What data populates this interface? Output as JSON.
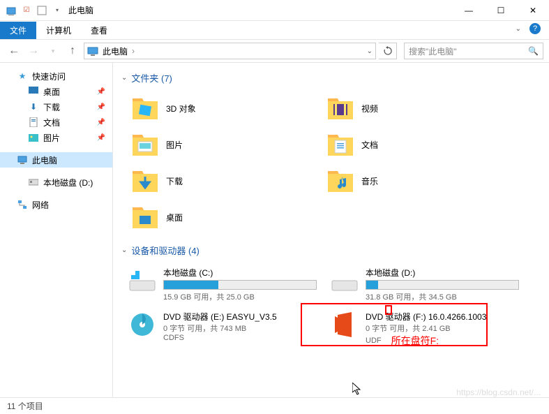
{
  "window": {
    "title": "此电脑",
    "minimize": "—",
    "maximize": "☐",
    "close": "✕"
  },
  "ribbon": {
    "file": "文件",
    "computer": "计算机",
    "view": "查看"
  },
  "address": {
    "location": "此电脑",
    "sep": "›"
  },
  "search": {
    "placeholder": "搜索\"此电脑\""
  },
  "sidebar": {
    "quick_access": "快速访问",
    "desktop": "桌面",
    "downloads": "下载",
    "documents": "文档",
    "pictures": "图片",
    "this_pc": "此电脑",
    "local_d": "本地磁盘 (D:)",
    "network": "网络"
  },
  "groups": {
    "folders": "文件夹 (7)",
    "devices": "设备和驱动器 (4)"
  },
  "folders": {
    "objects3d": "3D 对象",
    "videos": "视频",
    "pictures": "图片",
    "documents": "文档",
    "downloads": "下载",
    "music": "音乐",
    "desktop": "桌面"
  },
  "drives": {
    "c": {
      "name": "本地磁盘 (C:)",
      "meta": "15.9 GB 可用，共 25.0 GB",
      "fill": 36
    },
    "d": {
      "name": "本地磁盘 (D:)",
      "meta": "31.8 GB 可用，共 34.5 GB",
      "fill": 8
    },
    "e": {
      "name": "DVD 驱动器 (E:) EASYU_V3.5",
      "meta": "0 字节 可用，共 743 MB",
      "fs": "CDFS"
    },
    "f": {
      "name": "DVD 驱动器 (F:) 16.0.4266.1003",
      "meta": "0 字节 可用，共 2.41 GB",
      "fs": "UDF"
    }
  },
  "annotation": {
    "note": "所在盘符F:"
  },
  "status": {
    "items": "11 个项目"
  },
  "watermark": "https://blog.csdn.net/..."
}
